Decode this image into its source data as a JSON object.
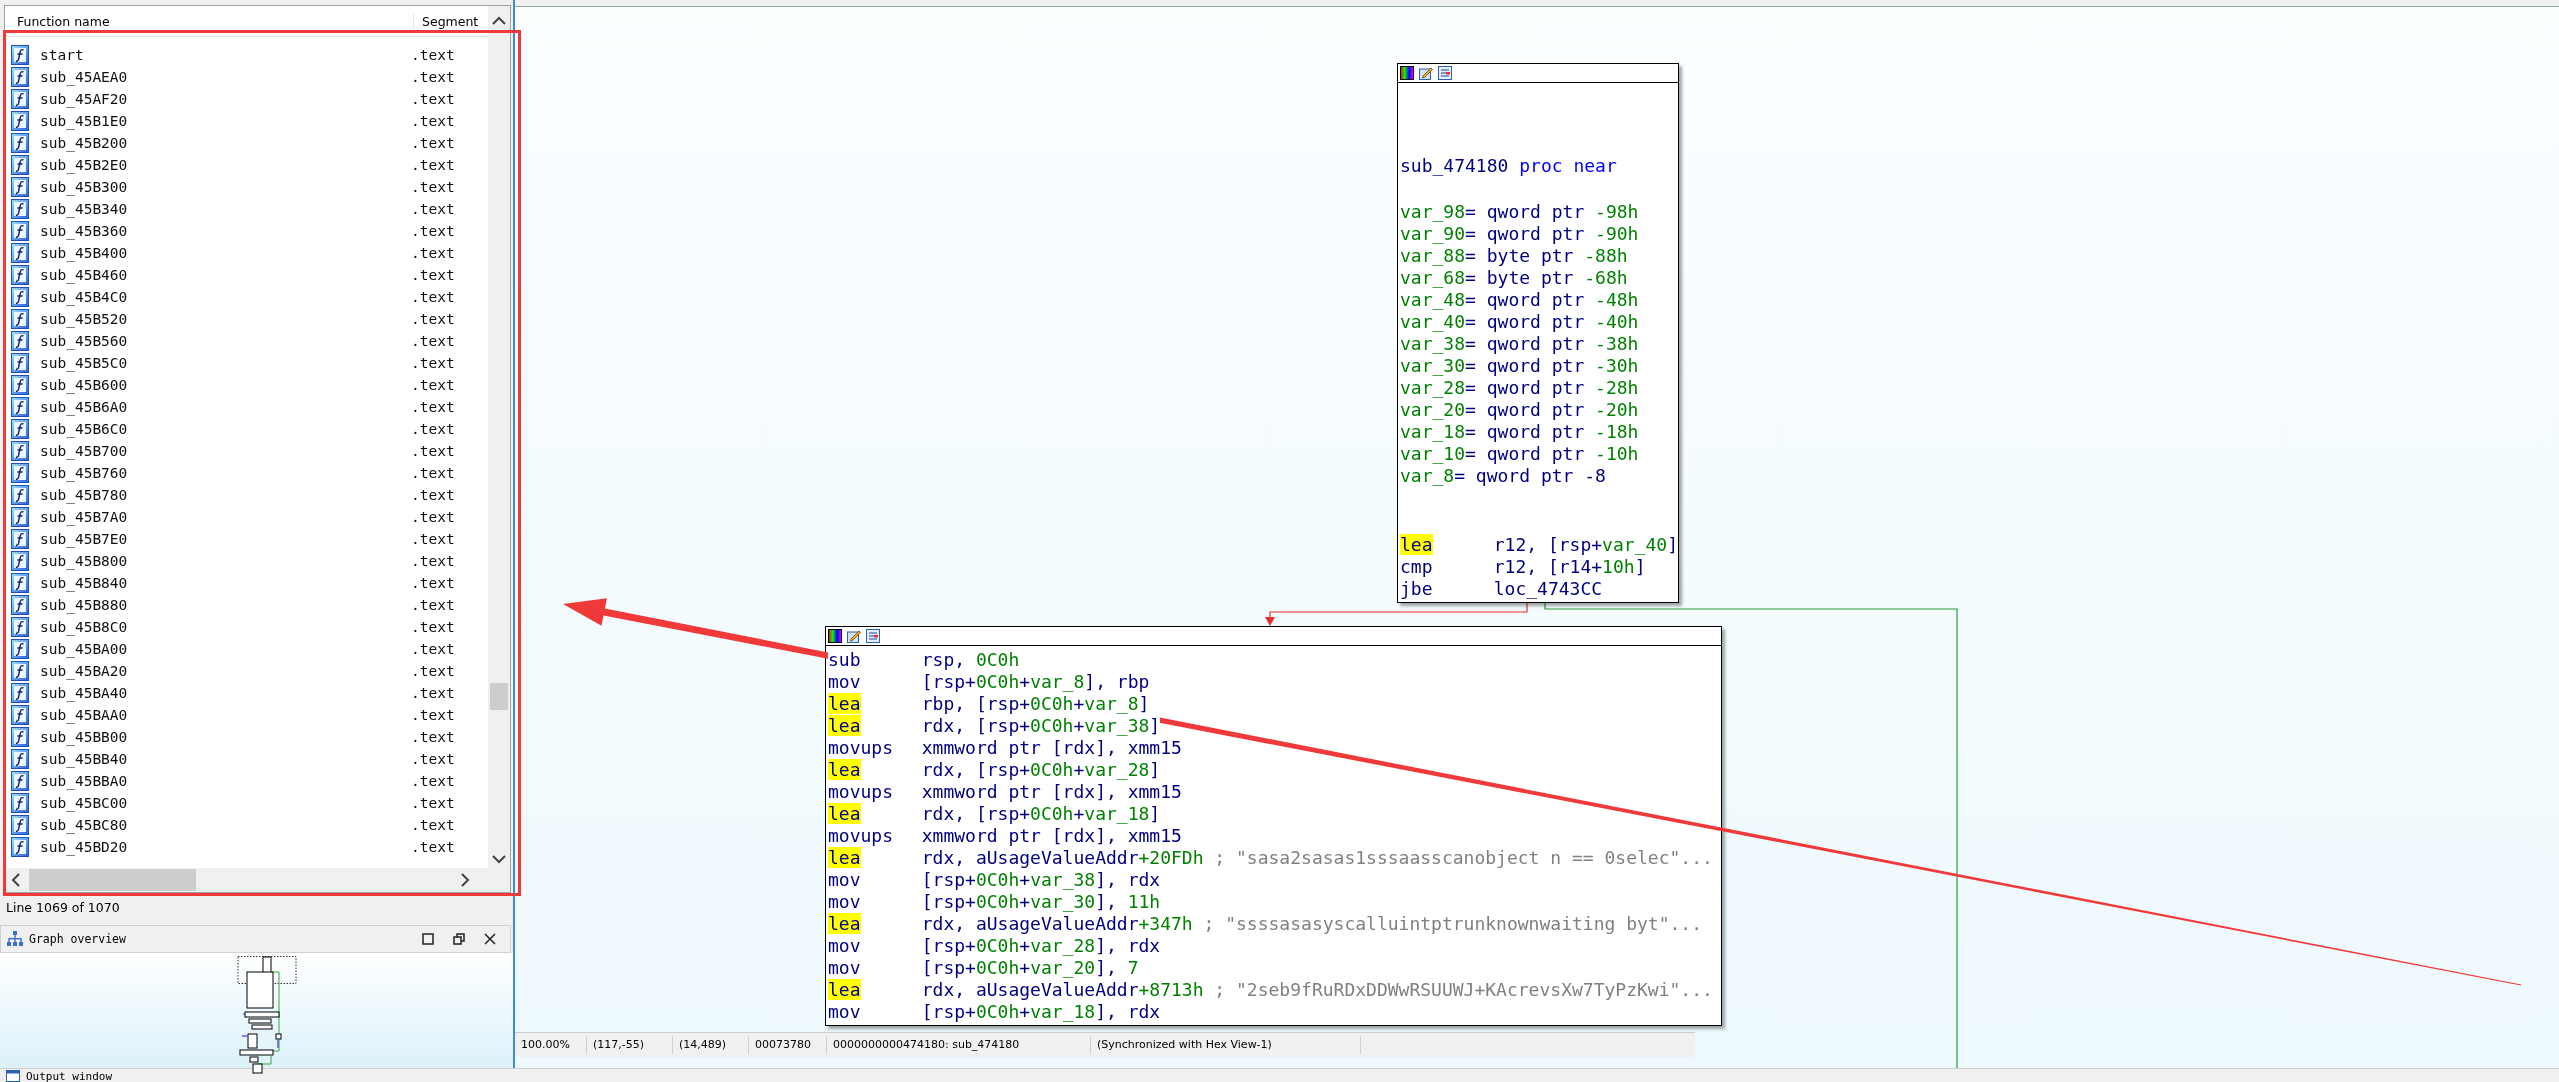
{
  "function_list": {
    "columns": [
      "Function name",
      "Segment"
    ],
    "rows": [
      {
        "name": "start",
        "segment": ".text"
      },
      {
        "name": "sub_45AEA0",
        "segment": ".text"
      },
      {
        "name": "sub_45AF20",
        "segment": ".text"
      },
      {
        "name": "sub_45B1E0",
        "segment": ".text"
      },
      {
        "name": "sub_45B200",
        "segment": ".text"
      },
      {
        "name": "sub_45B2E0",
        "segment": ".text"
      },
      {
        "name": "sub_45B300",
        "segment": ".text"
      },
      {
        "name": "sub_45B340",
        "segment": ".text"
      },
      {
        "name": "sub_45B360",
        "segment": ".text"
      },
      {
        "name": "sub_45B400",
        "segment": ".text"
      },
      {
        "name": "sub_45B460",
        "segment": ".text"
      },
      {
        "name": "sub_45B4C0",
        "segment": ".text"
      },
      {
        "name": "sub_45B520",
        "segment": ".text"
      },
      {
        "name": "sub_45B560",
        "segment": ".text"
      },
      {
        "name": "sub_45B5C0",
        "segment": ".text"
      },
      {
        "name": "sub_45B600",
        "segment": ".text"
      },
      {
        "name": "sub_45B6A0",
        "segment": ".text"
      },
      {
        "name": "sub_45B6C0",
        "segment": ".text"
      },
      {
        "name": "sub_45B700",
        "segment": ".text"
      },
      {
        "name": "sub_45B760",
        "segment": ".text"
      },
      {
        "name": "sub_45B780",
        "segment": ".text"
      },
      {
        "name": "sub_45B7A0",
        "segment": ".text"
      },
      {
        "name": "sub_45B7E0",
        "segment": ".text"
      },
      {
        "name": "sub_45B800",
        "segment": ".text"
      },
      {
        "name": "sub_45B840",
        "segment": ".text"
      },
      {
        "name": "sub_45B880",
        "segment": ".text"
      },
      {
        "name": "sub_45B8C0",
        "segment": ".text"
      },
      {
        "name": "sub_45BA00",
        "segment": ".text"
      },
      {
        "name": "sub_45BA20",
        "segment": ".text"
      },
      {
        "name": "sub_45BA40",
        "segment": ".text"
      },
      {
        "name": "sub_45BAA0",
        "segment": ".text"
      },
      {
        "name": "sub_45BB00",
        "segment": ".text"
      },
      {
        "name": "sub_45BB40",
        "segment": ".text"
      },
      {
        "name": "sub_45BBA0",
        "segment": ".text"
      },
      {
        "name": "sub_45BC00",
        "segment": ".text"
      },
      {
        "name": "sub_45BC80",
        "segment": ".text"
      },
      {
        "name": "sub_45BD20",
        "segment": ".text"
      }
    ],
    "status": "Line 1069 of 1070"
  },
  "graph_overview": {
    "title": "Graph overview"
  },
  "graph": {
    "nodes": [
      {
        "title": [
          {
            "text": "sub_474180 ",
            "kind": "plain"
          },
          {
            "text": "proc near",
            "kind": "keyword"
          }
        ],
        "vars": [
          [
            {
              "text": "var_98",
              "kind": "symbol"
            },
            {
              "text": "= qword ptr ",
              "kind": "plain"
            },
            {
              "text": "-98h",
              "kind": "symbol"
            }
          ],
          [
            {
              "text": "var_90",
              "kind": "symbol"
            },
            {
              "text": "= qword ptr ",
              "kind": "plain"
            },
            {
              "text": "-90h",
              "kind": "symbol"
            }
          ],
          [
            {
              "text": "var_88",
              "kind": "symbol"
            },
            {
              "text": "= byte ptr ",
              "kind": "plain"
            },
            {
              "text": "-88h",
              "kind": "symbol"
            }
          ],
          [
            {
              "text": "var_68",
              "kind": "symbol"
            },
            {
              "text": "= byte ptr ",
              "kind": "plain"
            },
            {
              "text": "-68h",
              "kind": "symbol"
            }
          ],
          [
            {
              "text": "var_48",
              "kind": "symbol"
            },
            {
              "text": "= qword ptr ",
              "kind": "plain"
            },
            {
              "text": "-48h",
              "kind": "symbol"
            }
          ],
          [
            {
              "text": "var_40",
              "kind": "symbol"
            },
            {
              "text": "= qword ptr ",
              "kind": "plain"
            },
            {
              "text": "-40h",
              "kind": "symbol"
            }
          ],
          [
            {
              "text": "var_38",
              "kind": "symbol"
            },
            {
              "text": "= qword ptr ",
              "kind": "plain"
            },
            {
              "text": "-38h",
              "kind": "symbol"
            }
          ],
          [
            {
              "text": "var_30",
              "kind": "symbol"
            },
            {
              "text": "= qword ptr ",
              "kind": "plain"
            },
            {
              "text": "-30h",
              "kind": "symbol"
            }
          ],
          [
            {
              "text": "var_28",
              "kind": "symbol"
            },
            {
              "text": "= qword ptr ",
              "kind": "plain"
            },
            {
              "text": "-28h",
              "kind": "symbol"
            }
          ],
          [
            {
              "text": "var_20",
              "kind": "symbol"
            },
            {
              "text": "= qword ptr ",
              "kind": "plain"
            },
            {
              "text": "-20h",
              "kind": "symbol"
            }
          ],
          [
            {
              "text": "var_18",
              "kind": "symbol"
            },
            {
              "text": "= qword ptr ",
              "kind": "plain"
            },
            {
              "text": "-18h",
              "kind": "symbol"
            }
          ],
          [
            {
              "text": "var_10",
              "kind": "symbol"
            },
            {
              "text": "= qword ptr ",
              "kind": "plain"
            },
            {
              "text": "-10h",
              "kind": "symbol"
            }
          ],
          [
            {
              "text": "var_8",
              "kind": "symbol"
            },
            {
              "text": "= qword ptr -8",
              "kind": "plain"
            }
          ]
        ],
        "code": [
          {
            "op": "lea",
            "highlighted": true,
            "args": [
              {
                "text": "r12, [rsp+",
                "kind": "plain"
              },
              {
                "text": "var_40",
                "kind": "symbol"
              },
              {
                "text": "]",
                "kind": "plain"
              }
            ]
          },
          {
            "op": "cmp",
            "highlighted": false,
            "args": [
              {
                "text": "r12, [r14+",
                "kind": "plain"
              },
              {
                "text": "10h",
                "kind": "symbol"
              },
              {
                "text": "]",
                "kind": "plain"
              }
            ]
          },
          {
            "op": "jbe",
            "highlighted": false,
            "args": [
              {
                "text": "loc_4743CC",
                "kind": "plain"
              }
            ]
          }
        ]
      },
      {
        "code": [
          {
            "op": "sub",
            "highlighted": false,
            "args": [
              {
                "text": "rsp, ",
                "kind": "plain"
              },
              {
                "text": "0C0h",
                "kind": "symbol"
              }
            ]
          },
          {
            "op": "mov",
            "highlighted": false,
            "args": [
              {
                "text": "[rsp+",
                "kind": "plain"
              },
              {
                "text": "0C0h",
                "kind": "symbol"
              },
              {
                "text": "+",
                "kind": "plain"
              },
              {
                "text": "var_8",
                "kind": "symbol"
              },
              {
                "text": "], rbp",
                "kind": "plain"
              }
            ]
          },
          {
            "op": "lea",
            "highlighted": true,
            "args": [
              {
                "text": "rbp, [rsp+",
                "kind": "plain"
              },
              {
                "text": "0C0h",
                "kind": "symbol"
              },
              {
                "text": "+",
                "kind": "plain"
              },
              {
                "text": "var_8",
                "kind": "symbol"
              },
              {
                "text": "]",
                "kind": "plain"
              }
            ]
          },
          {
            "op": "lea",
            "highlighted": true,
            "args": [
              {
                "text": "rdx, [rsp+",
                "kind": "plain"
              },
              {
                "text": "0C0h",
                "kind": "symbol"
              },
              {
                "text": "+",
                "kind": "plain"
              },
              {
                "text": "var_38",
                "kind": "symbol"
              },
              {
                "text": "]",
                "kind": "plain"
              }
            ]
          },
          {
            "op": "movups",
            "highlighted": false,
            "args": [
              {
                "text": "xmmword ptr [rdx], xmm15",
                "kind": "plain"
              }
            ]
          },
          {
            "op": "lea",
            "highlighted": true,
            "args": [
              {
                "text": "rdx, [rsp+",
                "kind": "plain"
              },
              {
                "text": "0C0h",
                "kind": "symbol"
              },
              {
                "text": "+",
                "kind": "plain"
              },
              {
                "text": "var_28",
                "kind": "symbol"
              },
              {
                "text": "]",
                "kind": "plain"
              }
            ]
          },
          {
            "op": "movups",
            "highlighted": false,
            "args": [
              {
                "text": "xmmword ptr [rdx], xmm15",
                "kind": "plain"
              }
            ]
          },
          {
            "op": "lea",
            "highlighted": true,
            "args": [
              {
                "text": "rdx, [rsp+",
                "kind": "plain"
              },
              {
                "text": "0C0h",
                "kind": "symbol"
              },
              {
                "text": "+",
                "kind": "plain"
              },
              {
                "text": "var_18",
                "kind": "symbol"
              },
              {
                "text": "]",
                "kind": "plain"
              }
            ]
          },
          {
            "op": "movups",
            "highlighted": false,
            "args": [
              {
                "text": "xmmword ptr [rdx], xmm15",
                "kind": "plain"
              }
            ]
          },
          {
            "op": "lea",
            "highlighted": true,
            "args": [
              {
                "text": "rdx, aUsageValueAddr",
                "kind": "plain"
              },
              {
                "text": "+20FDh",
                "kind": "symbol"
              },
              {
                "text": " ; \"sasa2sasas1sssaasscanobject n == 0selec\"...",
                "kind": "comment"
              }
            ]
          },
          {
            "op": "mov",
            "highlighted": false,
            "args": [
              {
                "text": "[rsp+",
                "kind": "plain"
              },
              {
                "text": "0C0h",
                "kind": "symbol"
              },
              {
                "text": "+",
                "kind": "plain"
              },
              {
                "text": "var_38",
                "kind": "symbol"
              },
              {
                "text": "], rdx",
                "kind": "plain"
              }
            ]
          },
          {
            "op": "mov",
            "highlighted": false,
            "args": [
              {
                "text": "[rsp+",
                "kind": "plain"
              },
              {
                "text": "0C0h",
                "kind": "symbol"
              },
              {
                "text": "+",
                "kind": "plain"
              },
              {
                "text": "var_30",
                "kind": "symbol"
              },
              {
                "text": "], ",
                "kind": "plain"
              },
              {
                "text": "11h",
                "kind": "symbol"
              }
            ]
          },
          {
            "op": "lea",
            "highlighted": true,
            "args": [
              {
                "text": "rdx, aUsageValueAddr",
                "kind": "plain"
              },
              {
                "text": "+347h",
                "kind": "symbol"
              },
              {
                "text": " ; \"ssssasasyscalluintptrunknownwaiting byt\"...",
                "kind": "comment"
              }
            ]
          },
          {
            "op": "mov",
            "highlighted": false,
            "args": [
              {
                "text": "[rsp+",
                "kind": "plain"
              },
              {
                "text": "0C0h",
                "kind": "symbol"
              },
              {
                "text": "+",
                "kind": "plain"
              },
              {
                "text": "var_28",
                "kind": "symbol"
              },
              {
                "text": "], rdx",
                "kind": "plain"
              }
            ]
          },
          {
            "op": "mov",
            "highlighted": false,
            "args": [
              {
                "text": "[rsp+",
                "kind": "plain"
              },
              {
                "text": "0C0h",
                "kind": "symbol"
              },
              {
                "text": "+",
                "kind": "plain"
              },
              {
                "text": "var_20",
                "kind": "symbol"
              },
              {
                "text": "], ",
                "kind": "plain"
              },
              {
                "text": "7",
                "kind": "symbol"
              }
            ]
          },
          {
            "op": "lea",
            "highlighted": true,
            "args": [
              {
                "text": "rdx, aUsageValueAddr",
                "kind": "plain"
              },
              {
                "text": "+8713h",
                "kind": "symbol"
              },
              {
                "text": " ; \"2seb9fRuRDxDDWwRSUUWJ+KAcrevsXw7TyPzKwi\"...",
                "kind": "comment"
              }
            ]
          },
          {
            "op": "mov",
            "highlighted": false,
            "args": [
              {
                "text": "[rsp+",
                "kind": "plain"
              },
              {
                "text": "0C0h",
                "kind": "symbol"
              },
              {
                "text": "+",
                "kind": "plain"
              },
              {
                "text": "var_18",
                "kind": "symbol"
              },
              {
                "text": "], rdx",
                "kind": "plain"
              }
            ]
          }
        ]
      }
    ]
  },
  "status_bar": [
    "100.00%",
    "(117,-55)",
    "(14,489)",
    "00073780",
    "0000000000474180: sub_474180",
    "(Synchronized with Hex View-1)"
  ],
  "output_window": {
    "title": "Output window"
  }
}
